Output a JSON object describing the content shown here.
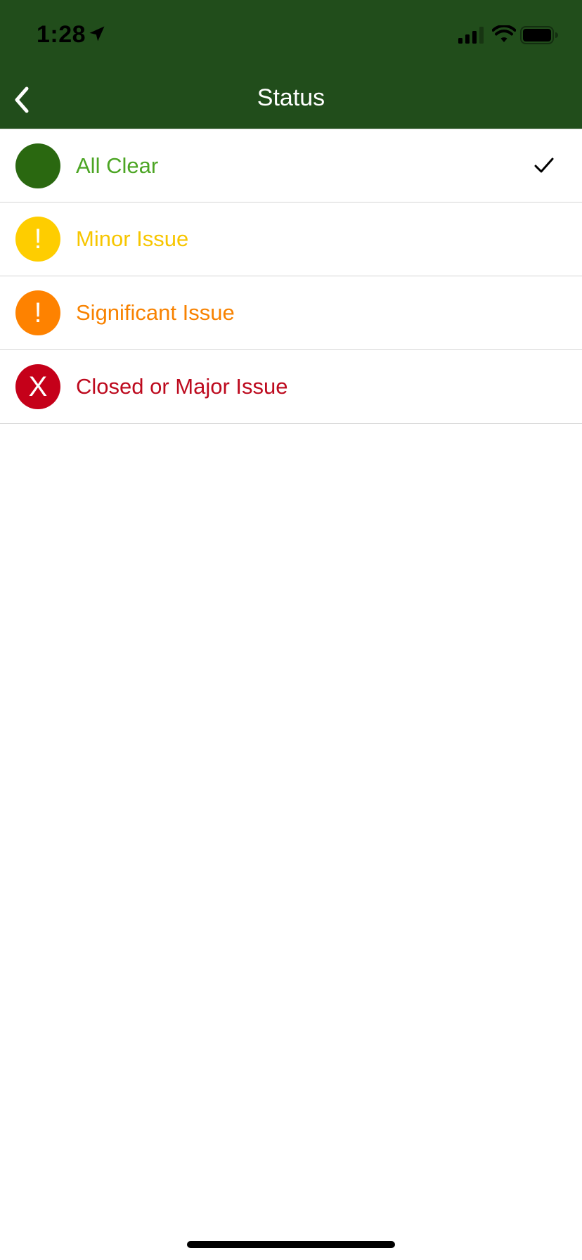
{
  "status_bar": {
    "time": "1:28",
    "location_icon": "location-arrow-icon",
    "signal_icon": "cellular-signal-icon",
    "wifi_icon": "wifi-icon",
    "battery_icon": "battery-icon"
  },
  "nav": {
    "back_icon": "chevron-left-icon",
    "title": "Status",
    "background_color": "#214d1b"
  },
  "statuses": [
    {
      "label": "All Clear",
      "symbol": "",
      "color": "#2a6810",
      "text_color": "#4ca524",
      "selected": true
    },
    {
      "label": "Minor Issue",
      "symbol": "!",
      "color": "#fecd00",
      "text_color": "#f7c600",
      "selected": false
    },
    {
      "label": "Significant Issue",
      "symbol": "!",
      "color": "#fe8200",
      "text_color": "#f88200",
      "selected": false
    },
    {
      "label": "Closed or Major Issue",
      "symbol": "X",
      "color": "#c50019",
      "text_color": "#bd0a1e",
      "selected": false
    }
  ],
  "selected_indicator_icon": "checkmark-icon"
}
